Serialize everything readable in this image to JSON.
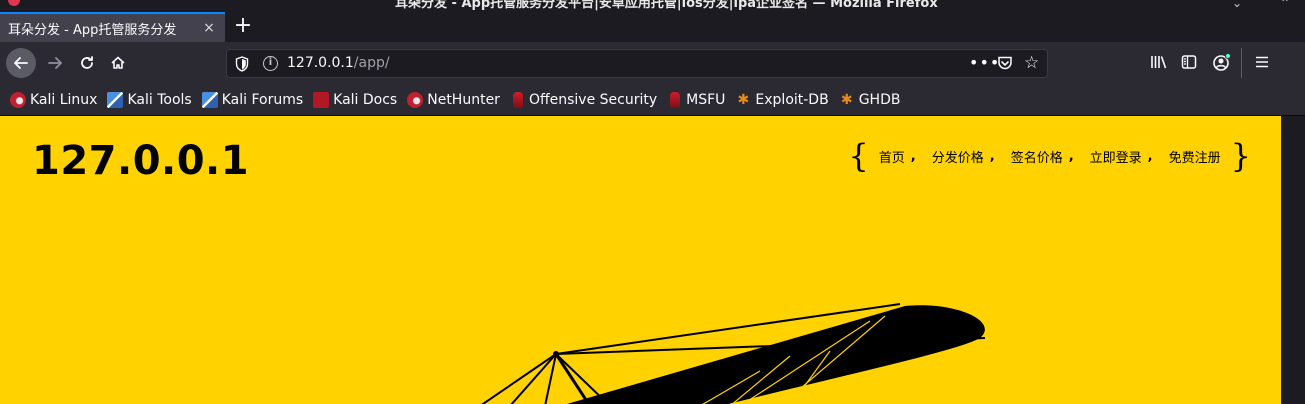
{
  "window": {
    "title": "耳朵分发 - App托管服务分发平台|安卓应用托管|ios分发|ipa企业签名 — Mozilla Firefox"
  },
  "tab": {
    "title": "耳朵分发 - App托管服务分发",
    "close_label": "×"
  },
  "nav": {
    "new_tab_label": "+"
  },
  "url": {
    "host": "127.0.0.1",
    "path": "/app/"
  },
  "bookmarks": [
    {
      "label": "Kali Linux",
      "icon": "kali-icon"
    },
    {
      "label": "Kali Tools",
      "icon": "kali-tools-icon"
    },
    {
      "label": "Kali Forums",
      "icon": "kali-tools-icon"
    },
    {
      "label": "Kali Docs",
      "icon": "kali-docs-icon"
    },
    {
      "label": "NetHunter",
      "icon": "kali-icon"
    },
    {
      "label": "Offensive Security",
      "icon": "offsec-icon"
    },
    {
      "label": "MSFU",
      "icon": "offsec-icon"
    },
    {
      "label": "Exploit-DB",
      "icon": "exploit-db-icon"
    },
    {
      "label": "GHDB",
      "icon": "exploit-db-icon"
    }
  ],
  "site": {
    "title": "127.0.0.1",
    "brace_open": "{",
    "brace_close": "}",
    "nav": [
      "首页",
      "分发价格",
      "签名价格",
      "立即登录",
      "免费注册"
    ],
    "separator": ","
  },
  "colors": {
    "page_background": "#ffd200",
    "browser_chrome": "#2b2a33",
    "tab_accent": "#0a84ff"
  }
}
